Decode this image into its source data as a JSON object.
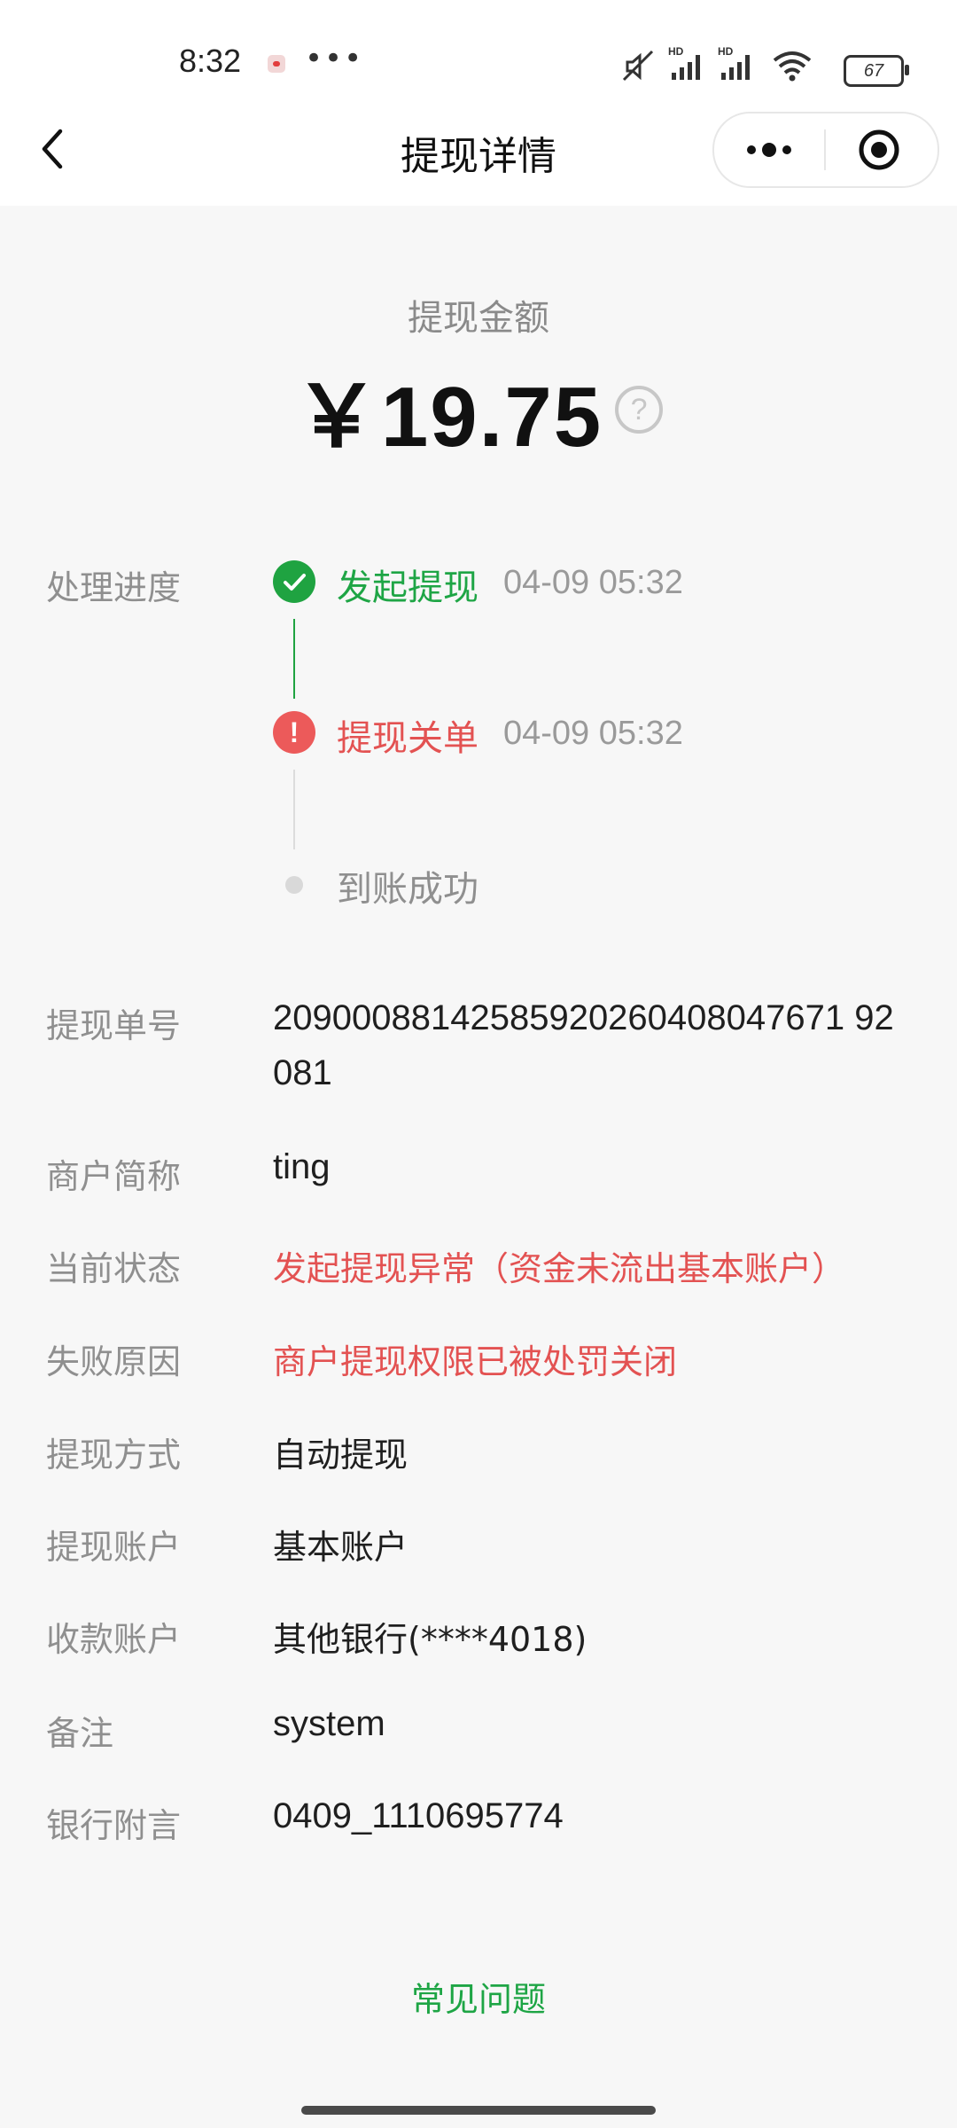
{
  "status_bar": {
    "time": "8:32",
    "battery": "67",
    "icons": [
      "notification-icon",
      "mute-icon",
      "signal-hd-icon",
      "signal-hd-icon",
      "wifi-icon",
      "battery-icon"
    ]
  },
  "nav": {
    "title": "提现详情"
  },
  "amount": {
    "label": "提现金额",
    "value": "￥19.75",
    "help": "?"
  },
  "progress": {
    "label": "处理进度",
    "steps": [
      {
        "text": "发起提现",
        "time": "04-09 05:32",
        "status": "success"
      },
      {
        "text": "提现关单",
        "time": "04-09 05:32",
        "status": "error"
      },
      {
        "text": "到账成功",
        "time": "",
        "status": "pending"
      }
    ]
  },
  "details": {
    "order_no": {
      "label": "提现单号",
      "line1": "20900088142585920260408047671 92",
      "line2": "081"
    },
    "merchant": {
      "label": "商户简称",
      "value": "ting"
    },
    "status": {
      "label": "当前状态",
      "value": "发起提现异常（资金未流出基本账户）"
    },
    "reason": {
      "label": "失败原因",
      "value": "商户提现权限已被处罚关闭"
    },
    "method": {
      "label": "提现方式",
      "value": "自动提现"
    },
    "account": {
      "label": "提现账户",
      "value": "基本账户"
    },
    "receiver": {
      "label": "收款账户",
      "value": "其他银行(****4018)"
    },
    "remark": {
      "label": "备注",
      "value": "system"
    },
    "bank_note": {
      "label": "银行附言",
      "value": "0409_1110695774"
    }
  },
  "faq": "常见问题",
  "colors": {
    "success": "#1fa341",
    "error": "#ec5a5a",
    "link": "#1ea545"
  }
}
